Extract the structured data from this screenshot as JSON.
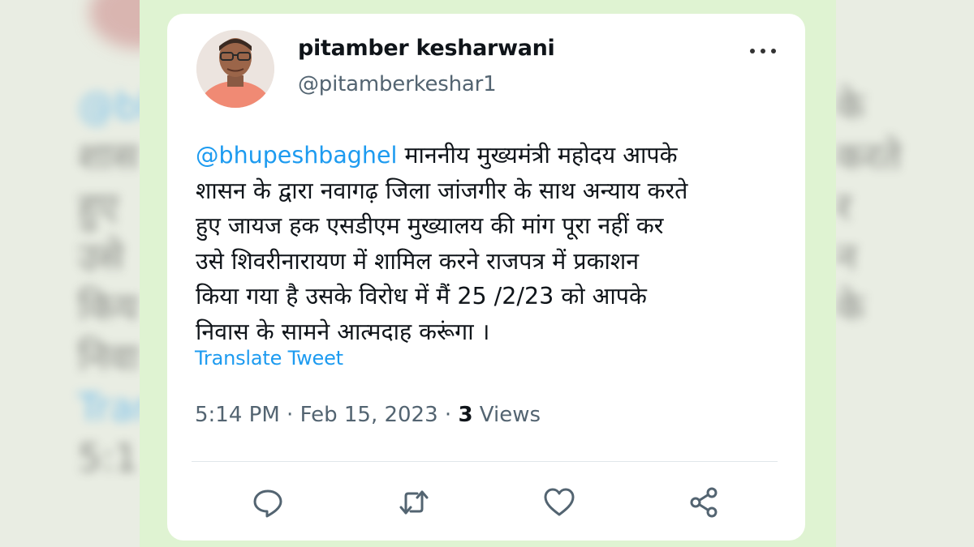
{
  "tweet": {
    "author": {
      "display_name": "pitamber kesharwani",
      "handle": "@pitamberkeshar1"
    },
    "text": {
      "mention": "@bhupeshbaghel",
      "line1": " माननीय मुख्यमंत्री महोदय आपके",
      "line2": "शासन के द्वारा नवागढ़ जिला जांजगीर के साथ अन्याय करते",
      "line3": "हुए जायज हक एसडीएम मुख्यालय की मांग पूरा नहीं कर",
      "line4": "उसे शिवरीनारायण में शामिल करने राजपत्र में प्रकाशन",
      "line5": "किया गया है उसके विरोध में मैं 25 /2/23 को आपके",
      "line6": "निवास के सामने आत्मदाह करूंगा ।"
    },
    "translate_label": "Translate Tweet",
    "time": "5:14 PM",
    "separator": " · ",
    "date": "Feb 15, 2023",
    "views_count": "3",
    "views_label": " Views"
  },
  "actions": [
    {
      "icon": "reply-icon"
    },
    {
      "icon": "retweet-icon"
    },
    {
      "icon": "like-icon"
    },
    {
      "icon": "share-icon"
    }
  ],
  "colors": {
    "accent": "#1d9bf0",
    "frame_green": "#dff3d2",
    "secondary_text": "#536471"
  }
}
